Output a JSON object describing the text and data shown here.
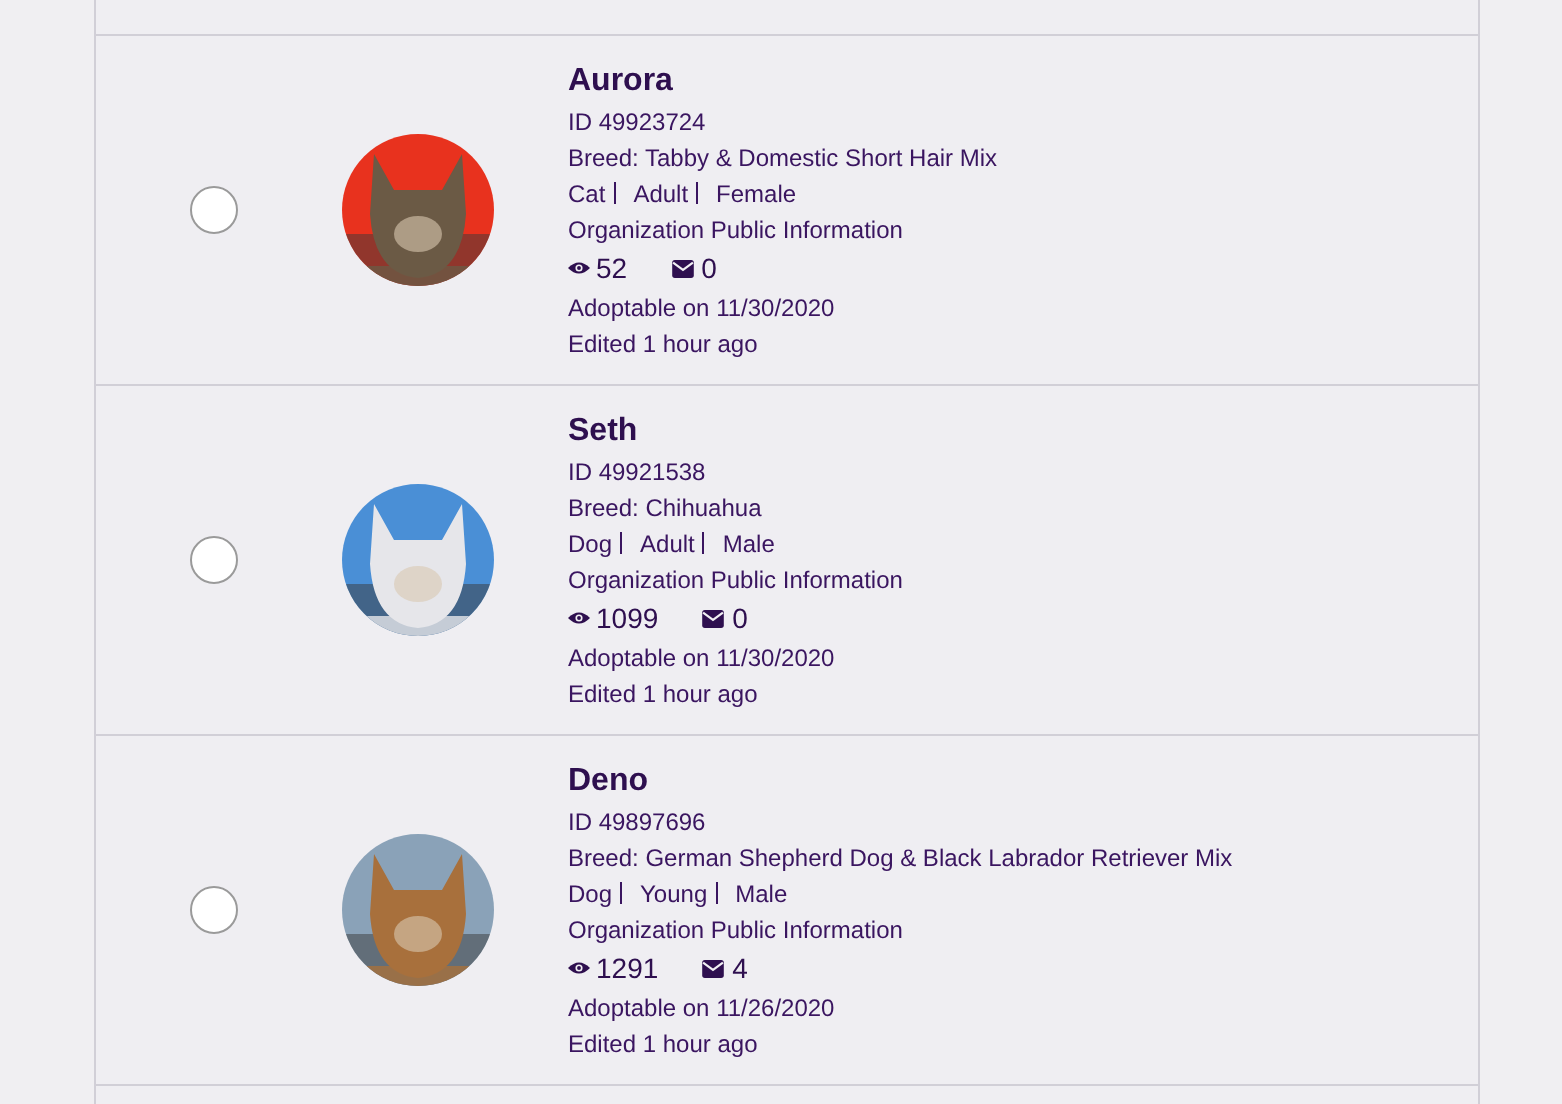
{
  "pets": [
    {
      "name": "Aurora",
      "id": "ID 49923724",
      "breed": "Breed: Tabby & Domestic Short Hair Mix",
      "species": "Cat",
      "age": "Adult",
      "sex": "Female",
      "visibility": "Organization Public Information",
      "views": "52",
      "messages": "0",
      "adoptable": "Adoptable on 11/30/2020",
      "edited": "Edited 1 hour ago",
      "selected": false
    },
    {
      "name": "Seth",
      "id": "ID 49921538",
      "breed": "Breed: Chihuahua",
      "species": "Dog",
      "age": "Adult",
      "sex": "Male",
      "visibility": "Organization Public Information",
      "views": "1099",
      "messages": "0",
      "adoptable": "Adoptable on 11/30/2020",
      "edited": "Edited 1 hour ago",
      "selected": false
    },
    {
      "name": "Deno",
      "id": "ID 49897696",
      "breed": "Breed: German Shepherd Dog & Black Labrador Retriever Mix",
      "species": "Dog",
      "age": "Young",
      "sex": "Male",
      "visibility": "Organization Public Information",
      "views": "1291",
      "messages": "4",
      "adoptable": "Adoptable on 11/26/2020",
      "edited": "Edited 1 hour ago",
      "selected": false
    }
  ]
}
